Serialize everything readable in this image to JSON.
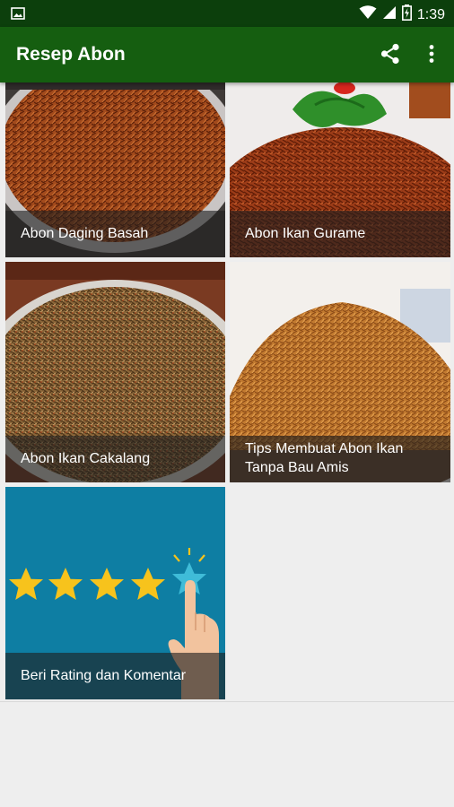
{
  "status_bar": {
    "time": "1:39",
    "icons": [
      "gallery-icon",
      "wifi-icon",
      "cell-signal-icon",
      "battery-icon"
    ],
    "color": "#0c3f0c"
  },
  "app_bar": {
    "title": "Resep Abon",
    "actions": [
      "share-icon",
      "more-vert-icon"
    ],
    "color": "#155e10"
  },
  "recipes": [
    {
      "title": "Abon Daging Basah"
    },
    {
      "title": "Abon Ikan Gurame"
    },
    {
      "title": "Abon Ikan Cakalang"
    },
    {
      "title": "Tips Membuat Abon Ikan",
      "title_line2": "Tanpa Bau Amis"
    },
    {
      "title": "Beri Rating dan Komentar"
    }
  ],
  "colors": {
    "background": "#eeeeee",
    "rating_tile": "#0e7ea3",
    "star": "#f7c31c"
  }
}
